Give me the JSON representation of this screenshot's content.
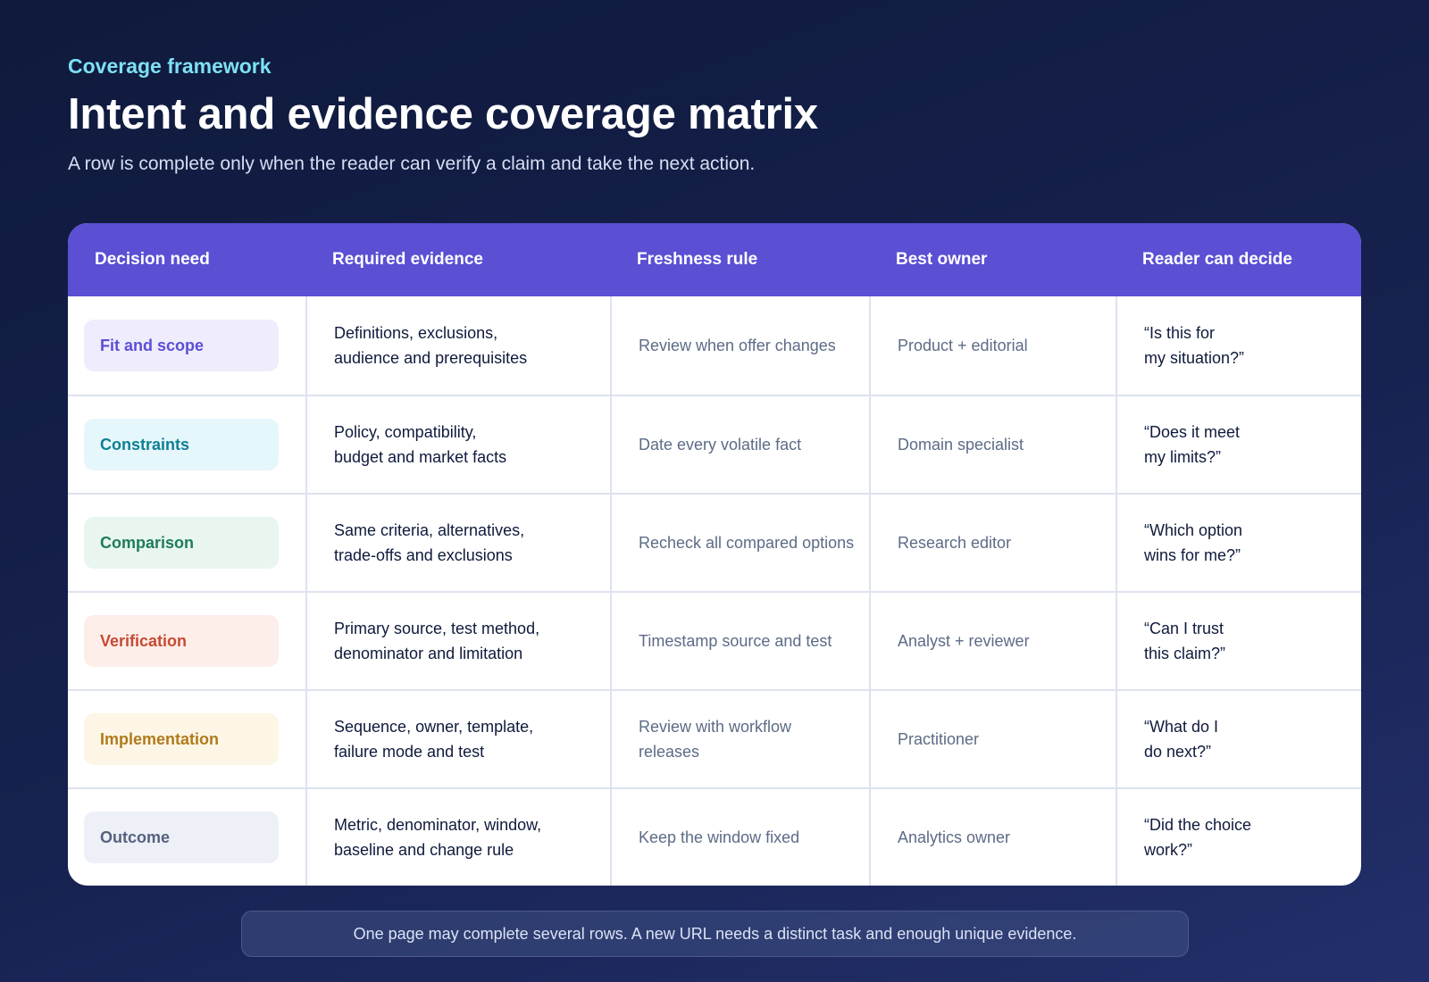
{
  "header": {
    "eyebrow": "Coverage framework",
    "title": "Intent and evidence coverage matrix",
    "subtitle": "A row is complete only when the reader can verify a claim and take the next action."
  },
  "table": {
    "columns": [
      "Decision need",
      "Required evidence",
      "Freshness rule",
      "Best owner",
      "Reader can decide"
    ],
    "rows": [
      {
        "need": "Fit and scope",
        "need_color": "#5b4fd4",
        "need_bg": "#efecfd",
        "evidence_line1": "Definitions, exclusions,",
        "evidence_line2": "audience and prerequisites",
        "freshness": "Review when offer changes",
        "owner": "Product + editorial",
        "decide_line1": "“Is this for",
        "decide_line2": "my situation?”"
      },
      {
        "need": "Constraints",
        "need_color": "#0e7f93",
        "need_bg": "#e6f7fc",
        "evidence_line1": "Policy, compatibility,",
        "evidence_line2": "budget and market facts",
        "freshness": "Date every volatile fact",
        "owner": "Domain specialist",
        "decide_line1": "“Does it meet",
        "decide_line2": "my limits?”"
      },
      {
        "need": "Comparison",
        "need_color": "#1f7d56",
        "need_bg": "#e8f6ef",
        "evidence_line1": "Same criteria, alternatives,",
        "evidence_line2": "trade-offs and exclusions",
        "freshness": "Recheck all compared options",
        "owner": "Research editor",
        "decide_line1": "“Which option",
        "decide_line2": "wins for me?”"
      },
      {
        "need": "Verification",
        "need_color": "#c74a33",
        "need_bg": "#fdeee9",
        "evidence_line1": "Primary source, test method,",
        "evidence_line2": "denominator and limitation",
        "freshness": "Timestamp source and test",
        "owner": "Analyst + reviewer",
        "decide_line1": "“Can I trust",
        "decide_line2": "this claim?”"
      },
      {
        "need": "Implementation",
        "need_color": "#b07a1c",
        "need_bg": "#fdf6e6",
        "evidence_line1": "Sequence, owner, template,",
        "evidence_line2": "failure mode and test",
        "freshness": "Review with workflow releases",
        "owner": "Practitioner",
        "decide_line1": "“What do I",
        "decide_line2": "do next?”"
      },
      {
        "need": "Outcome",
        "need_color": "#56627d",
        "need_bg": "#edf0f7",
        "evidence_line1": "Metric, denominator, window,",
        "evidence_line2": "baseline and change rule",
        "freshness": "Keep the window fixed",
        "owner": "Analytics owner",
        "decide_line1": "“Did the choice",
        "decide_line2": "work?”"
      }
    ]
  },
  "footer": {
    "note": "One page may complete several rows. A new URL needs a distinct task and enough unique evidence."
  },
  "colors": {
    "background": "#0f1a3c",
    "header_band": "#5b4fd4",
    "eyebrow": "#7ee0f5"
  }
}
